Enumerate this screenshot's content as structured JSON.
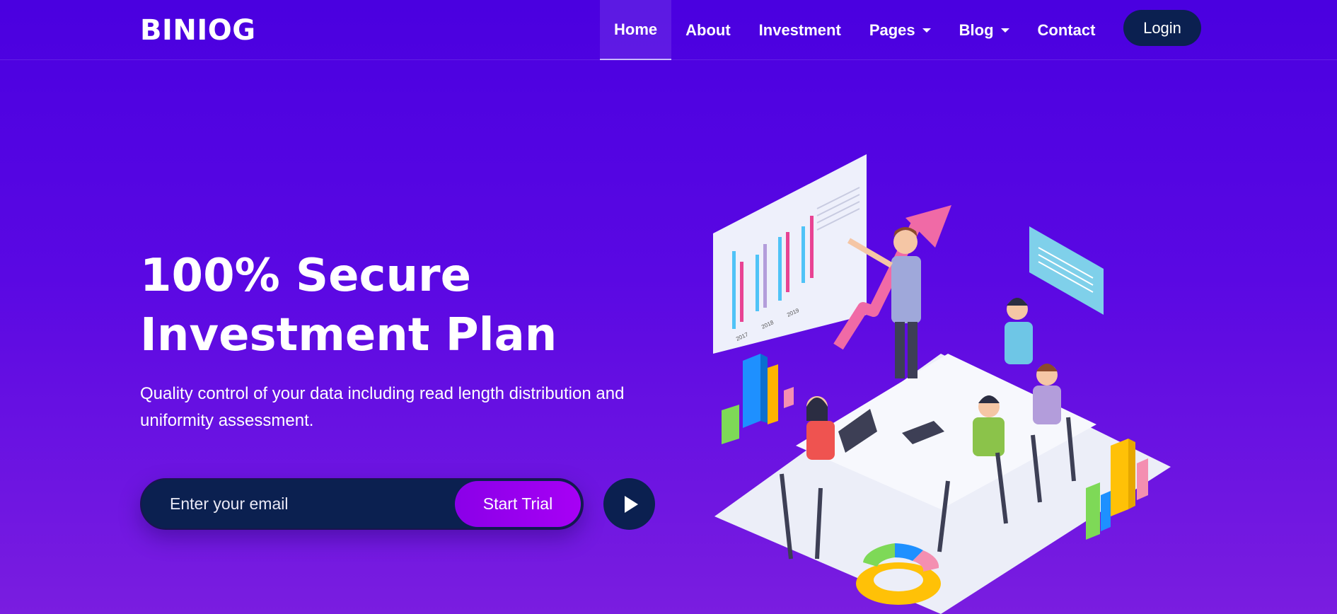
{
  "brand": {
    "logo_text": "BINIOG"
  },
  "nav": {
    "items": [
      {
        "label": "Home",
        "active": true,
        "dropdown": false
      },
      {
        "label": "About",
        "active": false,
        "dropdown": false
      },
      {
        "label": "Investment",
        "active": false,
        "dropdown": false
      },
      {
        "label": "Pages",
        "active": false,
        "dropdown": true
      },
      {
        "label": "Blog",
        "active": false,
        "dropdown": true
      },
      {
        "label": "Contact",
        "active": false,
        "dropdown": false
      }
    ],
    "login_label": "Login"
  },
  "hero": {
    "title_line1": "100% Secure",
    "title_line2": "Investment Plan",
    "subtitle": "Quality control of your data including read length distribution and uniformity assessment.",
    "email_placeholder": "Enter your email",
    "cta_label": "Start Trial",
    "play_icon": "play-icon"
  },
  "illustration": {
    "icon": "team-meeting-illustration",
    "board_years": [
      "2017",
      "2018",
      "2019"
    ]
  },
  "colors": {
    "background_top": "#4a00e0",
    "background_bottom": "#7a1de0",
    "dark_navy": "#0b2050",
    "cta_purple": "#a700f5"
  }
}
